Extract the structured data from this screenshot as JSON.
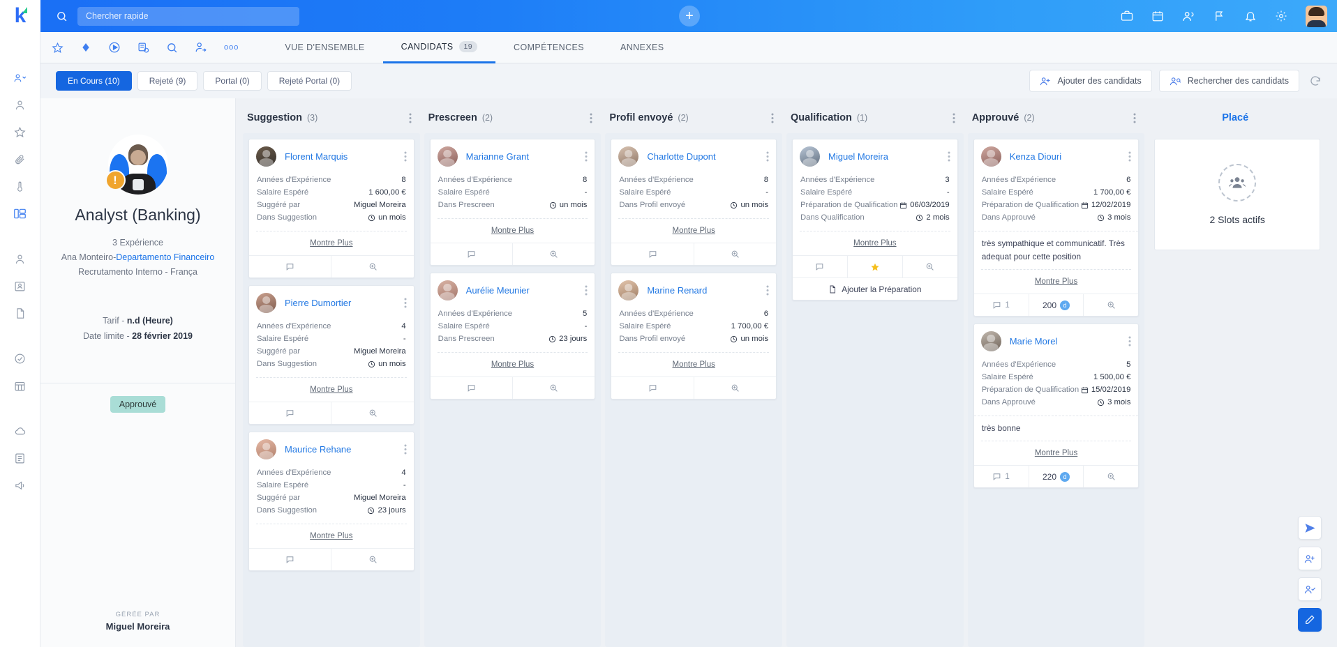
{
  "topbar": {
    "logo": "k-logo",
    "search_placeholder": "Chercher rapide",
    "search_value": "",
    "add_label": "+",
    "right_icons": [
      "briefcase-icon",
      "calendar-icon",
      "people-icon",
      "flag-icon",
      "bell-icon",
      "gear-icon",
      "avatar"
    ]
  },
  "iconbar": {
    "icons": [
      "star-icon",
      "diamond-icon",
      "play-circle-icon",
      "list-add-icon",
      "search-icon",
      "user-arrow-icon",
      "more-icon"
    ]
  },
  "tabs": [
    {
      "label": "VUE D'ENSEMBLE",
      "count": "",
      "active": false
    },
    {
      "label": "CANDIDATS",
      "count": "19",
      "active": true
    },
    {
      "label": "COMPÉTENCES",
      "count": "",
      "active": false
    },
    {
      "label": "ANNEXES",
      "count": "",
      "active": false
    }
  ],
  "rail": {
    "items": [
      "user-dropdown-icon",
      "person-icon",
      "star-icon",
      "paperclip-icon",
      "thermometer-icon",
      "kanban-icon",
      "user-outline-icon",
      "user-badge-icon",
      "document-icon",
      "check-circle-icon",
      "calendar-grid-icon",
      "cloud-icon",
      "note-icon",
      "megaphone-icon"
    ]
  },
  "filters": {
    "chips": [
      {
        "label": "En Cours (10)",
        "selected": true
      },
      {
        "label": "Rejeté (9)",
        "selected": false
      },
      {
        "label": "Portal (0)",
        "selected": false
      },
      {
        "label": "Rejeté Portal (0)",
        "selected": false
      }
    ],
    "add_candidates": "Ajouter des candidats",
    "search_candidates": "Rechercher des candidats",
    "refresh": "refresh-icon"
  },
  "job": {
    "title": "Analyst (Banking)",
    "experience": "3 Expérience",
    "owner": "Ana Monteiro-",
    "department": "Departamento Financeiro",
    "recruitment": "Recrutamento Interno  -  França",
    "rate_label": "Tarif  -  ",
    "rate_value": "n.d  (Heure)",
    "deadline_label": "Date limite  -  ",
    "deadline_value": "28 février 2019",
    "status_badge": "Approuvé",
    "managed_by_label": "GÉRÉE PAR",
    "managed_by": "Miguel Moreira"
  },
  "labels": {
    "years": "Années d'Expérience",
    "salary": "Salaire Espéré",
    "suggested_by": "Suggéré par",
    "in_suggestion": "Dans Suggestion",
    "in_prescreen": "Dans Prescreen",
    "in_profile_sent": "Dans Profil envoyé",
    "qual_prep": "Préparation de Qualification",
    "in_qualification": "Dans Qualification",
    "in_approved": "Dans Approuvé",
    "show_more": "Montre Plus",
    "add_prep": "Ajouter la Préparation"
  },
  "columns": [
    {
      "title": "Suggestion",
      "count": "(3)",
      "cards": [
        {
          "name": "Florent Marquis",
          "photo": "ph-a",
          "fields": [
            {
              "label": "Années d'Expérience",
              "value": "8"
            },
            {
              "label": "Salaire Espéré",
              "value": "1 600,00 €"
            },
            {
              "label": "Suggéré par",
              "value": "Miguel Moreira"
            },
            {
              "label": "Dans Suggestion",
              "value": "un mois",
              "icon": "clock"
            }
          ],
          "note": "",
          "show_more": "Montre Plus",
          "actions": [
            "comment-icon",
            "zoom-icon"
          ]
        },
        {
          "name": "Pierre Dumortier",
          "photo": "ph-b",
          "fields": [
            {
              "label": "Années d'Expérience",
              "value": "4"
            },
            {
              "label": "Salaire Espéré",
              "value": "-"
            },
            {
              "label": "Suggéré par",
              "value": "Miguel Moreira"
            },
            {
              "label": "Dans Suggestion",
              "value": "un mois",
              "icon": "clock"
            }
          ],
          "note": "",
          "show_more": "Montre Plus",
          "actions": [
            "comment-icon",
            "zoom-icon"
          ]
        },
        {
          "name": "Maurice Rehane",
          "photo": "ph-c",
          "fields": [
            {
              "label": "Années d'Expérience",
              "value": "4"
            },
            {
              "label": "Salaire Espéré",
              "value": "-"
            },
            {
              "label": "Suggéré par",
              "value": "Miguel Moreira"
            },
            {
              "label": "Dans Suggestion",
              "value": "23 jours",
              "icon": "clock"
            }
          ],
          "note": "",
          "show_more": "Montre Plus",
          "actions": [
            "comment-icon",
            "zoom-icon"
          ]
        }
      ]
    },
    {
      "title": "Prescreen",
      "count": "(2)",
      "cards": [
        {
          "name": "Marianne Grant",
          "photo": "ph-f",
          "fields": [
            {
              "label": "Années d'Expérience",
              "value": "8"
            },
            {
              "label": "Salaire Espéré",
              "value": "-"
            },
            {
              "label": "Dans Prescreen",
              "value": "un mois",
              "icon": "clock"
            }
          ],
          "note": "",
          "show_more": "Montre Plus",
          "actions": [
            "comment-icon",
            "zoom-icon"
          ]
        },
        {
          "name": "Aurélie Meunier",
          "photo": "ph-h",
          "fields": [
            {
              "label": "Années d'Expérience",
              "value": "5"
            },
            {
              "label": "Salaire Espéré",
              "value": "-"
            },
            {
              "label": "Dans Prescreen",
              "value": "23 jours",
              "icon": "clock"
            }
          ],
          "note": "",
          "show_more": "Montre Plus",
          "actions": [
            "comment-icon",
            "zoom-icon"
          ]
        }
      ]
    },
    {
      "title": "Profil envoyé",
      "count": "(2)",
      "cards": [
        {
          "name": "Charlotte Dupont",
          "photo": "ph-d",
          "fields": [
            {
              "label": "Années d'Expérience",
              "value": "8"
            },
            {
              "label": "Salaire Espéré",
              "value": "-"
            },
            {
              "label": "Dans Profil envoyé",
              "value": "un mois",
              "icon": "clock"
            }
          ],
          "note": "",
          "show_more": "Montre Plus",
          "actions": [
            "comment-icon",
            "zoom-icon"
          ]
        },
        {
          "name": "Marine Renard",
          "photo": "ph-g",
          "fields": [
            {
              "label": "Années d'Expérience",
              "value": "6"
            },
            {
              "label": "Salaire Espéré",
              "value": "1 700,00 €"
            },
            {
              "label": "Dans Profil envoyé",
              "value": "un mois",
              "icon": "clock"
            }
          ],
          "note": "",
          "show_more": "Montre Plus",
          "actions": [
            "comment-icon",
            "zoom-icon"
          ]
        }
      ]
    },
    {
      "title": "Qualification",
      "count": "(1)",
      "cards": [
        {
          "name": "Miguel Moreira",
          "photo": "ph-e",
          "fields": [
            {
              "label": "Années d'Expérience",
              "value": "3"
            },
            {
              "label": "Salaire Espéré",
              "value": "-"
            },
            {
              "label": "Préparation de Qualification",
              "value": "06/03/2019",
              "icon": "calendar"
            },
            {
              "label": "Dans Qualification",
              "value": "2 mois",
              "icon": "clock"
            }
          ],
          "note": "",
          "show_more": "Montre Plus",
          "actions": [
            "comment-icon",
            "star-icon",
            "zoom-icon"
          ],
          "add_prep": "Ajouter la Préparation"
        }
      ]
    },
    {
      "title": "Approuvé",
      "count": "(2)",
      "cards": [
        {
          "name": "Kenza Diouri",
          "photo": "ph-f",
          "fields": [
            {
              "label": "Années d'Expérience",
              "value": "6"
            },
            {
              "label": "Salaire Espéré",
              "value": "1 700,00 €"
            },
            {
              "label": "Préparation de Qualification",
              "value": "12/02/2019",
              "icon": "calendar"
            },
            {
              "label": "Dans Approuvé",
              "value": "3 mois",
              "icon": "clock"
            }
          ],
          "note": "très sympathique et communicatif. Très adequat pour cette position",
          "show_more": "Montre Plus",
          "comment_count": "1",
          "score": "200",
          "score_unit": "d",
          "actions": [
            "comment-icon",
            "score",
            "zoom-icon"
          ]
        },
        {
          "name": "Marie Morel",
          "photo": "ph-i",
          "fields": [
            {
              "label": "Années d'Expérience",
              "value": "5"
            },
            {
              "label": "Salaire Espéré",
              "value": "1 500,00 €"
            },
            {
              "label": "Préparation de Qualification",
              "value": "15/02/2019",
              "icon": "calendar"
            },
            {
              "label": "Dans Approuvé",
              "value": "3 mois",
              "icon": "clock"
            }
          ],
          "note": "très bonne",
          "show_more": "Montre Plus",
          "comment_count": "1",
          "score": "220",
          "score_unit": "d",
          "actions": [
            "comment-icon",
            "score",
            "zoom-icon"
          ]
        }
      ]
    },
    {
      "title": "Placé",
      "count": "",
      "blue": true,
      "placed": {
        "text": "2 Slots actifs",
        "icon": "people-dashed-icon"
      },
      "cards": []
    }
  ],
  "fabs": [
    "send-icon",
    "add-user-icon",
    "user-check-icon",
    "edit-icon"
  ],
  "colors": {
    "accent": "#1566e0",
    "link": "#2278e3",
    "warn": "#f0a52e",
    "badge": "#a9ddd6",
    "star": "#f5bf1d"
  }
}
